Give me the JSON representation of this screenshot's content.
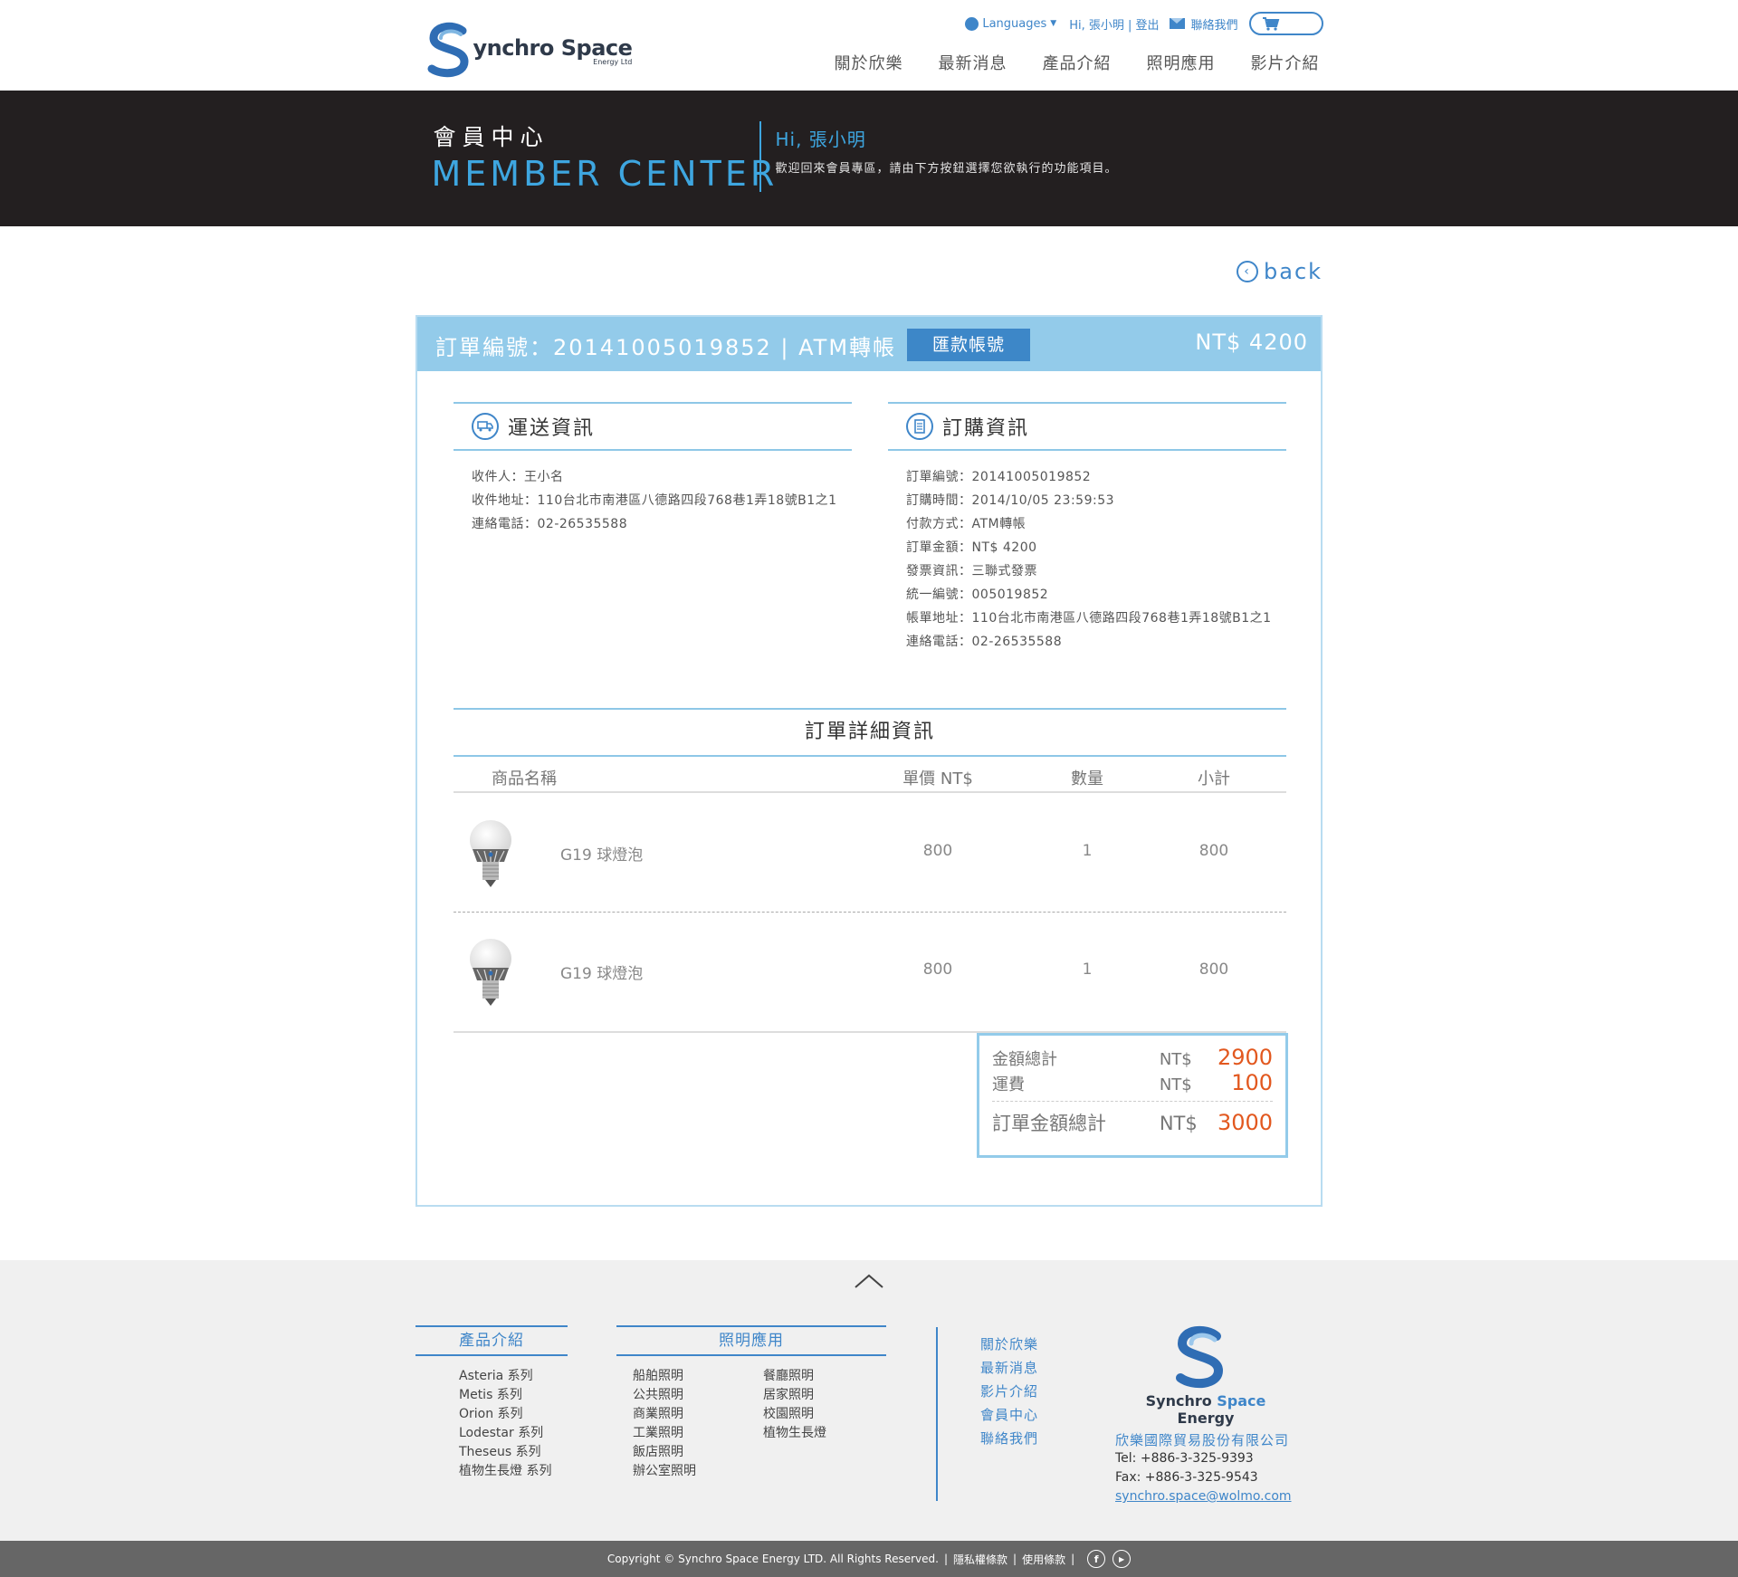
{
  "header": {
    "logo": {
      "main": "ynchro Space",
      "sub": "Energy Ltd"
    },
    "topbar": {
      "languages_label": "Languages",
      "greeting_logout": "Hi, 張小明 | 登出",
      "contact_label": "聯絡我們"
    },
    "nav": [
      "關於欣樂",
      "最新消息",
      "產品介紹",
      "照明應用",
      "影片介紹"
    ]
  },
  "banner": {
    "title_zh": "會員中心",
    "title_en": "MEMBER CENTER",
    "greeting": "Hi, 張小明",
    "description": "歡迎回來會員專區，請由下方按鈕選擇您欲執行的功能項目。"
  },
  "back_label": "back",
  "order": {
    "title": "訂單編號：20141005019852 | ATM轉帳",
    "remit_button": "匯款帳號",
    "total": "NT$ 4200",
    "shipping": {
      "title": "運送資訊",
      "fields": [
        {
          "k": "收件人：",
          "v": "王小名"
        },
        {
          "k": "收件地址：",
          "v": "110台北市南港區八德路四段768巷1弄18號B1之1"
        },
        {
          "k": "連絡電話：",
          "v": "02-26535588"
        }
      ]
    },
    "purchase": {
      "title": "訂購資訊",
      "fields": [
        {
          "k": "訂單編號：",
          "v": "20141005019852"
        },
        {
          "k": "訂購時間：",
          "v": "2014/10/05 23:59:53"
        },
        {
          "k": "付款方式：",
          "v": "ATM轉帳"
        },
        {
          "k": "訂單金額：",
          "v": "NT$ 4200"
        },
        {
          "k": "發票資訊：",
          "v": "三聯式發票"
        },
        {
          "k": "統一編號：",
          "v": "005019852"
        },
        {
          "k": "帳單地址：",
          "v": "110台北市南港區八德路四段768巷1弄18號B1之1"
        },
        {
          "k": "連絡電話：",
          "v": "02-26535588"
        }
      ]
    },
    "detail_title": "訂單詳細資訊",
    "columns": {
      "name": "商品名稱",
      "price": "單價 NT$",
      "qty": "數量",
      "subtotal": "小計"
    },
    "items": [
      {
        "name": "G19 球燈泡",
        "price": "800",
        "qty": "1",
        "subtotal": "800"
      },
      {
        "name": "G19 球燈泡",
        "price": "800",
        "qty": "1",
        "subtotal": "800"
      }
    ],
    "summary": {
      "items_total_label": "金額總計",
      "items_total_currency": "NT$",
      "items_total_value": "2900",
      "shipping_label": "運費",
      "shipping_currency": "NT$",
      "shipping_value": "100",
      "grand_total_label": "訂單金額總計",
      "grand_total_currency": "NT$",
      "grand_total_value": "3000",
      "accent_color": "#e2581f"
    }
  },
  "footer": {
    "products": {
      "title": "產品介紹",
      "items": [
        "Asteria 系列",
        "Metis 系列",
        "Orion 系列",
        "Lodestar 系列",
        "Theseus 系列",
        "植物生長燈 系列"
      ]
    },
    "lighting": {
      "title": "照明應用",
      "col1": [
        "船舶照明",
        "公共照明",
        "商業照明",
        "工業照明",
        "飯店照明",
        "辦公室照明"
      ],
      "col2": [
        "餐廳照明",
        "居家照明",
        "校園照明",
        "植物生長燈"
      ]
    },
    "links": [
      "關於欣樂",
      "最新消息",
      "影片介紹",
      "會員中心",
      "聯絡我們"
    ],
    "brand": {
      "name_a": "Synchro ",
      "name_b": "Space",
      "name_c": " Energy",
      "company": "欣樂國際貿易股份有限公司",
      "tel": "Tel: +886-3-325-9393",
      "fax": "Fax: +886-3-325-9543",
      "email": "synchro.space@wolmo.com"
    },
    "copyright": "Copyright © Synchro Space Energy LTD. All Rights Reserved.",
    "privacy": "隱私權條款",
    "terms": "使用條款",
    "social_facebook": "f",
    "social_youtube": "▶"
  },
  "colors": {
    "brand_blue": "#3f86c9",
    "light_blue": "#93cbea",
    "banner_bg": "#231f20",
    "accent_orange": "#e2581f"
  },
  "icons": [
    "globe-icon",
    "mail-icon",
    "cart-icon",
    "back-arrow-icon",
    "truck-icon",
    "document-icon",
    "bulb-image",
    "up-arrow-icon",
    "facebook-icon",
    "youtube-icon"
  ]
}
